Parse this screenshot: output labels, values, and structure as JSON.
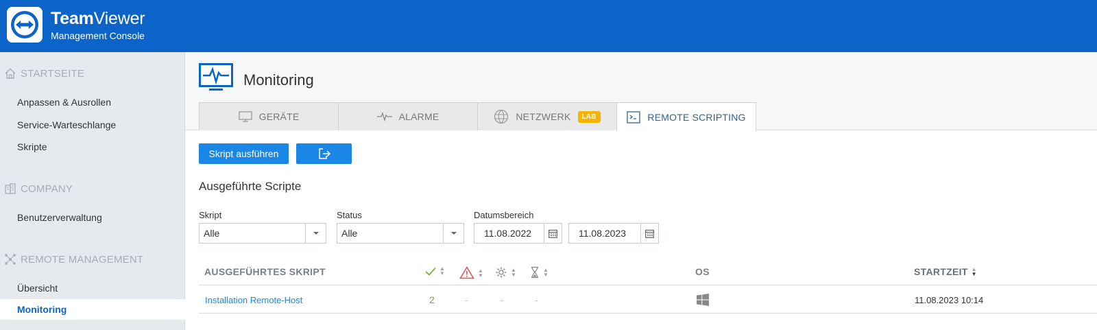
{
  "header": {
    "brand_bold": "Team",
    "brand_light": "Viewer",
    "subtitle": "Management Console"
  },
  "sidebar": {
    "sections": [
      {
        "label": "STARTSEITE",
        "icon": "home-icon"
      },
      {
        "label": "COMPANY",
        "icon": "building-icon"
      },
      {
        "label": "REMOTE MANAGEMENT",
        "icon": "network-icon"
      }
    ],
    "items": [
      {
        "label": "Anpassen & Ausrollen"
      },
      {
        "label": "Service-Warteschlange"
      },
      {
        "label": "Skripte"
      },
      {
        "label": "Benutzerverwaltung"
      },
      {
        "label": "Übersicht"
      },
      {
        "label": "Monitoring",
        "active": true
      }
    ]
  },
  "page": {
    "title": "Monitoring",
    "icon": "monitor-pulse-icon"
  },
  "tabs": [
    {
      "label": "GERÄTE",
      "icon": "monitor-icon"
    },
    {
      "label": "ALARME",
      "icon": "pulse-icon"
    },
    {
      "label": "NETZWERK",
      "icon": "globe-icon",
      "badge": "LAB"
    },
    {
      "label": "REMOTE SCRIPTING",
      "icon": "terminal-icon",
      "active": true
    }
  ],
  "toolbar": {
    "run_label": "Skript ausführen",
    "export_icon": "export-icon"
  },
  "section_title": "Ausgeführte Scripte",
  "filters": {
    "script_label": "Skript",
    "script_value": "Alle",
    "status_label": "Status",
    "status_value": "Alle",
    "date_label": "Datumsbereich",
    "date_from": "11.08.2022",
    "date_to": "11.08.2023"
  },
  "table": {
    "columns": {
      "script": "AUSGEFÜHRTES SKRIPT",
      "os": "OS",
      "start": "STARTZEIT"
    },
    "rows": [
      {
        "script": "Installation Remote-Host",
        "success": "2",
        "error": "-",
        "running": "-",
        "pending": "-",
        "os_icon": "windows-icon",
        "start": "11.08.2023 10:14"
      }
    ]
  },
  "colors": {
    "header_blue": "#0c64c8",
    "button_blue": "#1a87e6",
    "lab_badge": "#f5b400",
    "success_green": "#6fa83a",
    "error_red": "#d9534f"
  }
}
